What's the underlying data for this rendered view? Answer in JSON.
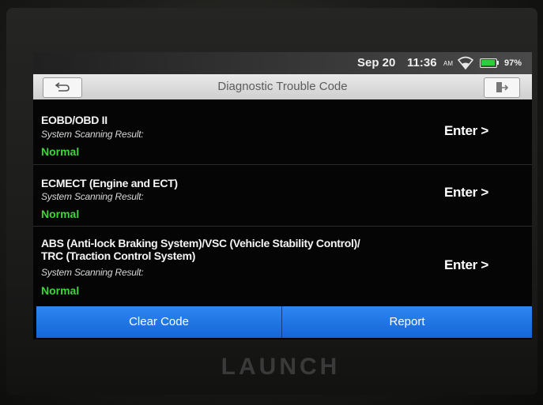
{
  "status_bar": {
    "date": "Sep 20",
    "time": "11:36",
    "ampm": "AM",
    "battery": "97%",
    "wifi_icon": "wifi-icon",
    "battery_icon": "battery-icon"
  },
  "title_bar": {
    "title": "Diagnostic Trouble Code",
    "back_icon": "back-arrow-icon",
    "exit_icon": "exit-icon"
  },
  "systems": [
    {
      "name_line1": "EOBD/OBD II",
      "name_line2": "",
      "sub": "System Scanning Result:",
      "result": "Normal",
      "action": "Enter >"
    },
    {
      "name_line1": "ECMECT (Engine and ECT)",
      "name_line2": "",
      "sub": "System Scanning Result:",
      "result": "Normal",
      "action": "Enter >"
    },
    {
      "name_line1": "ABS (Anti-lock Braking System)/VSC (Vehicle Stability Control)/",
      "name_line2": "TRC (Traction Control System)",
      "sub": "System Scanning Result:",
      "result": "Normal",
      "action": "Enter >"
    }
  ],
  "buttons": {
    "clear": "Clear Code",
    "report": "Report"
  },
  "brand": "LAUNCH",
  "colors": {
    "result_normal": "#3fd43a",
    "button_blue": "#1f78e8"
  }
}
